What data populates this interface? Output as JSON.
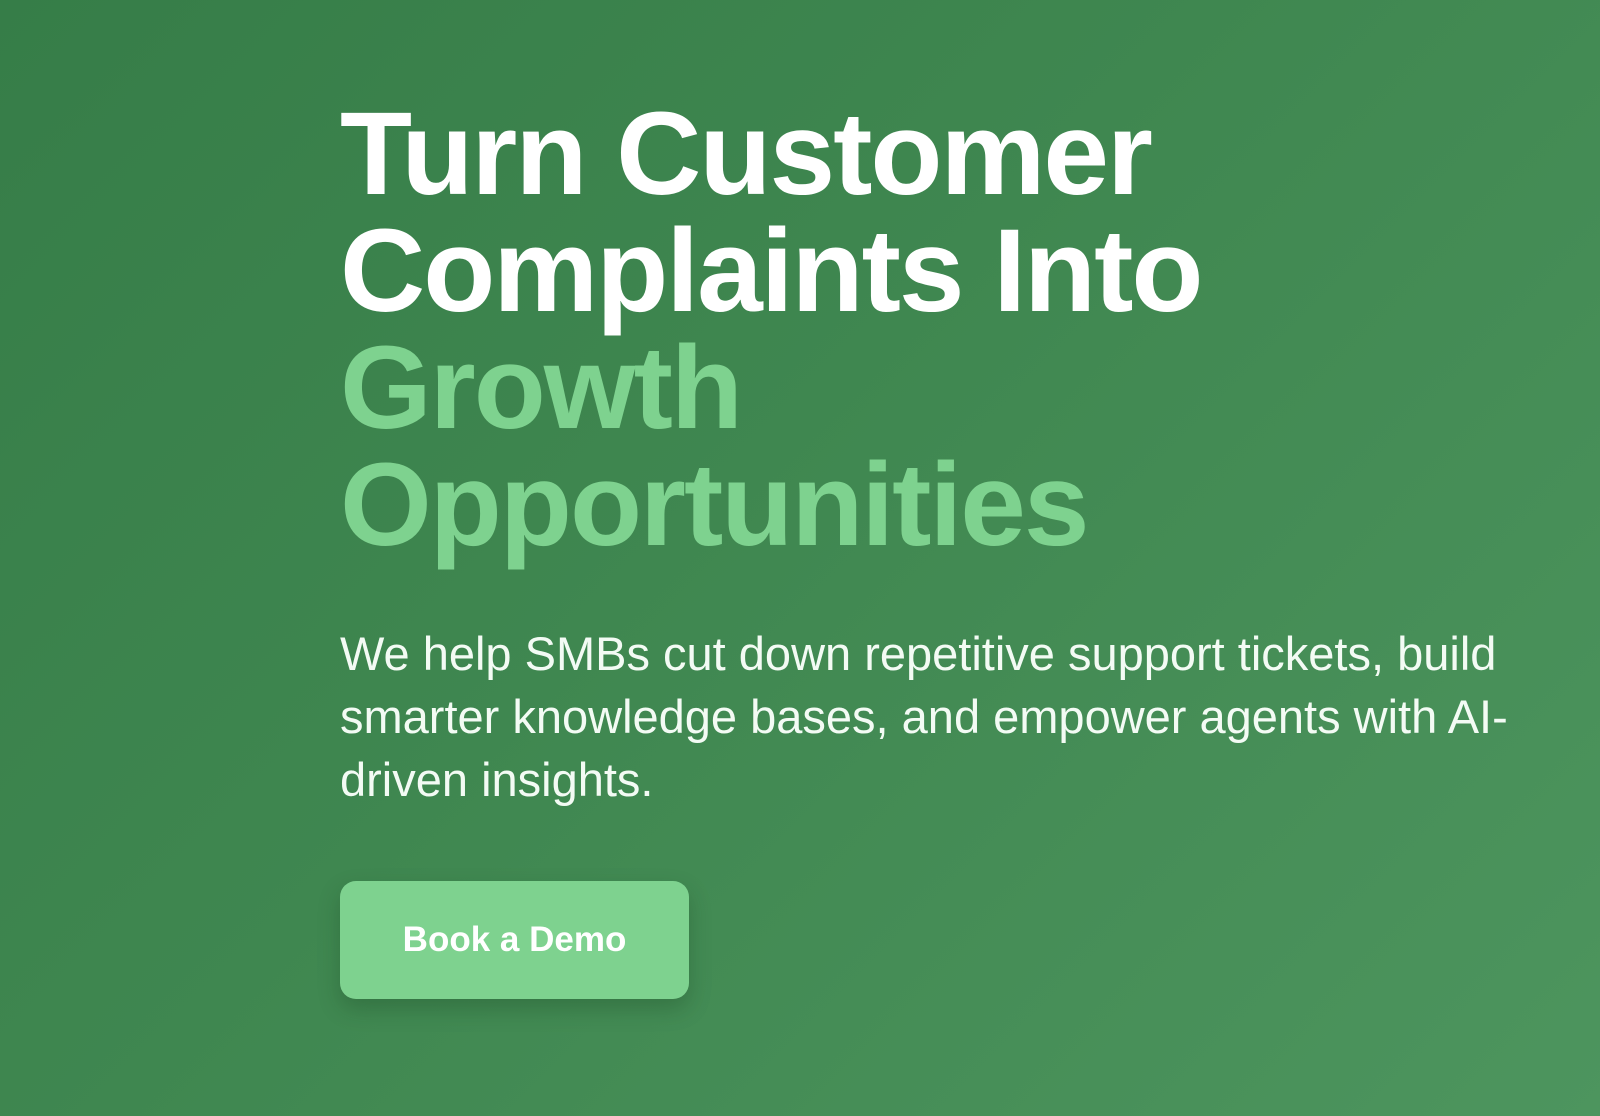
{
  "hero": {
    "headline": {
      "line1": "Turn Customer",
      "line2": "Complaints Into",
      "line3": "Growth",
      "line4": "Opportunities"
    },
    "subtitle": "We help SMBs cut down repetitive support tickets, build smarter knowledge bases, and empower agents with AI-driven insights.",
    "cta_label": "Book a Demo"
  },
  "colors": {
    "background": "#3f8750",
    "accent": "#7ed28f",
    "text": "#ffffff"
  }
}
